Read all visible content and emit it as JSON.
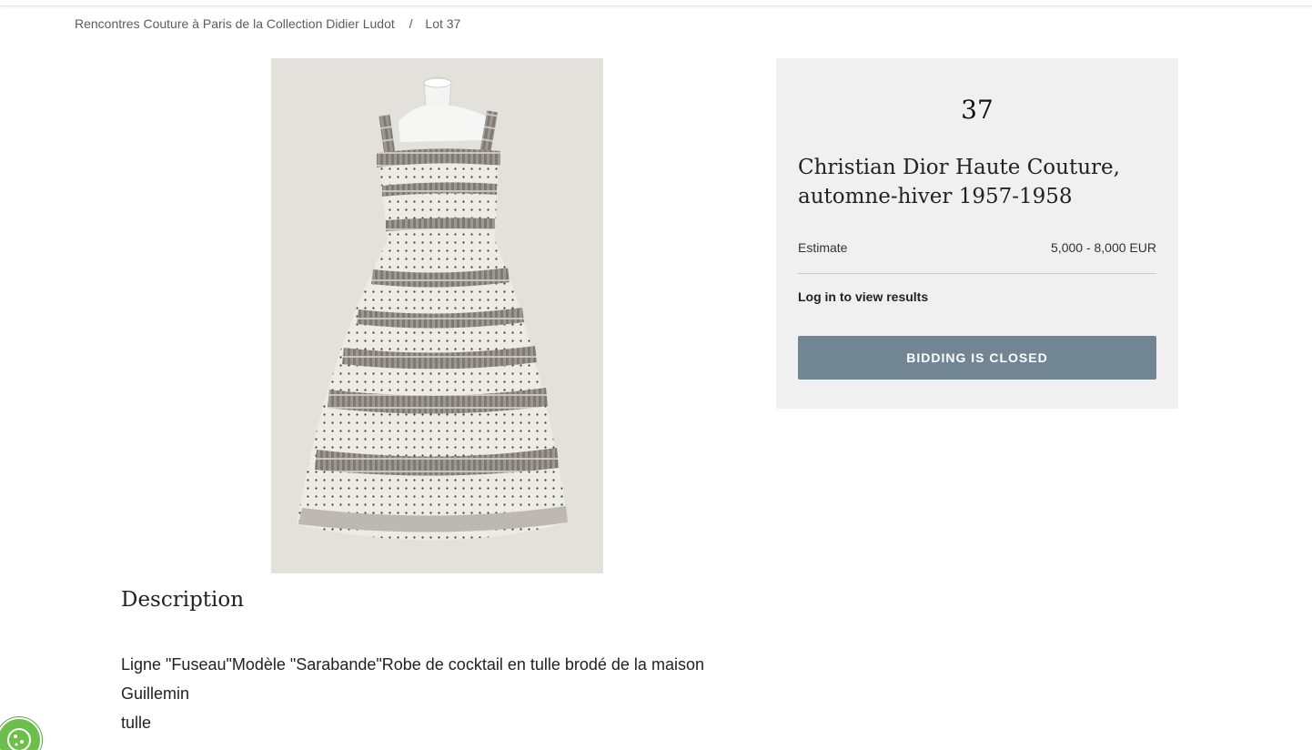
{
  "breadcrumb": {
    "sale": "Rencontres Couture à Paris de la Collection Didier Ludot",
    "separator": "/",
    "current": "Lot 37"
  },
  "image": {
    "alt": "Christian Dior Haute Couture cocktail dress on mannequin",
    "background_color": "#e2e1dc"
  },
  "panel": {
    "lot_number": "37",
    "title": "Christian Dior Haute Couture, automne-hiver 1957-1958",
    "estimate_label": "Estimate",
    "estimate_value": "5,000 - 8,000 EUR",
    "login_link": "Log in to view results",
    "bidding_button": "BIDDING IS CLOSED",
    "button_color": "#718592",
    "panel_color": "#f0f0f0"
  },
  "description": {
    "heading": "Description",
    "line1": "Ligne \"Fuseau\"Modèle \"Sarabande\"Robe de cocktail en tulle brodé de la maison Guillemin",
    "line2": "tulle"
  },
  "cookie": {
    "icon": "cookie-icon",
    "color": "#6cbf4a"
  }
}
